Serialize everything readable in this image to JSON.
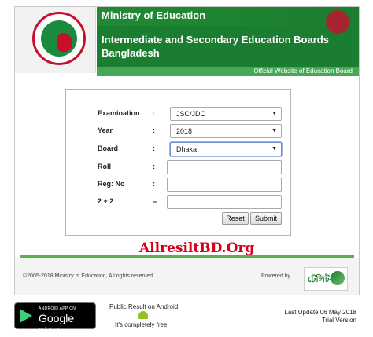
{
  "header": {
    "ministry": "Ministry of Education",
    "board_line1": "Intermediate and Secondary Education Boards",
    "board_line2": "Bangladesh",
    "official": "Official Website of Education Board",
    "colors": {
      "banner": "#1b7d2f",
      "subbar": "#46a855",
      "seal_red": "#c8102e"
    }
  },
  "form": {
    "examination": {
      "label": "Examination",
      "colon": ":",
      "value": "JSC/JDC"
    },
    "year": {
      "label": "Year",
      "colon": ":",
      "value": "2018"
    },
    "board": {
      "label": "Board",
      "colon": ":",
      "value": "Dhaka"
    },
    "roll": {
      "label": "Roll",
      "colon": ":",
      "value": ""
    },
    "reg": {
      "label": "Reg: No",
      "colon": ":",
      "value": ""
    },
    "captcha": {
      "label": "2 + 2",
      "colon": "=",
      "value": ""
    },
    "reset_label": "Reset",
    "submit_label": "Submit"
  },
  "watermark": "AllresiltBD.Org",
  "footer": {
    "copyright": "©2005-2018 Ministry of Education, All rights reserved.",
    "powered": "Powered by",
    "logo_text": "টেলিটক"
  },
  "bottom": {
    "gplay_small": "ANDROID APP ON",
    "gplay_big": "Google play",
    "public": "Public Result on Android",
    "free": "It's completely free!",
    "last_update": "Last Update 06 May 2018",
    "trial": "Trial Version"
  }
}
